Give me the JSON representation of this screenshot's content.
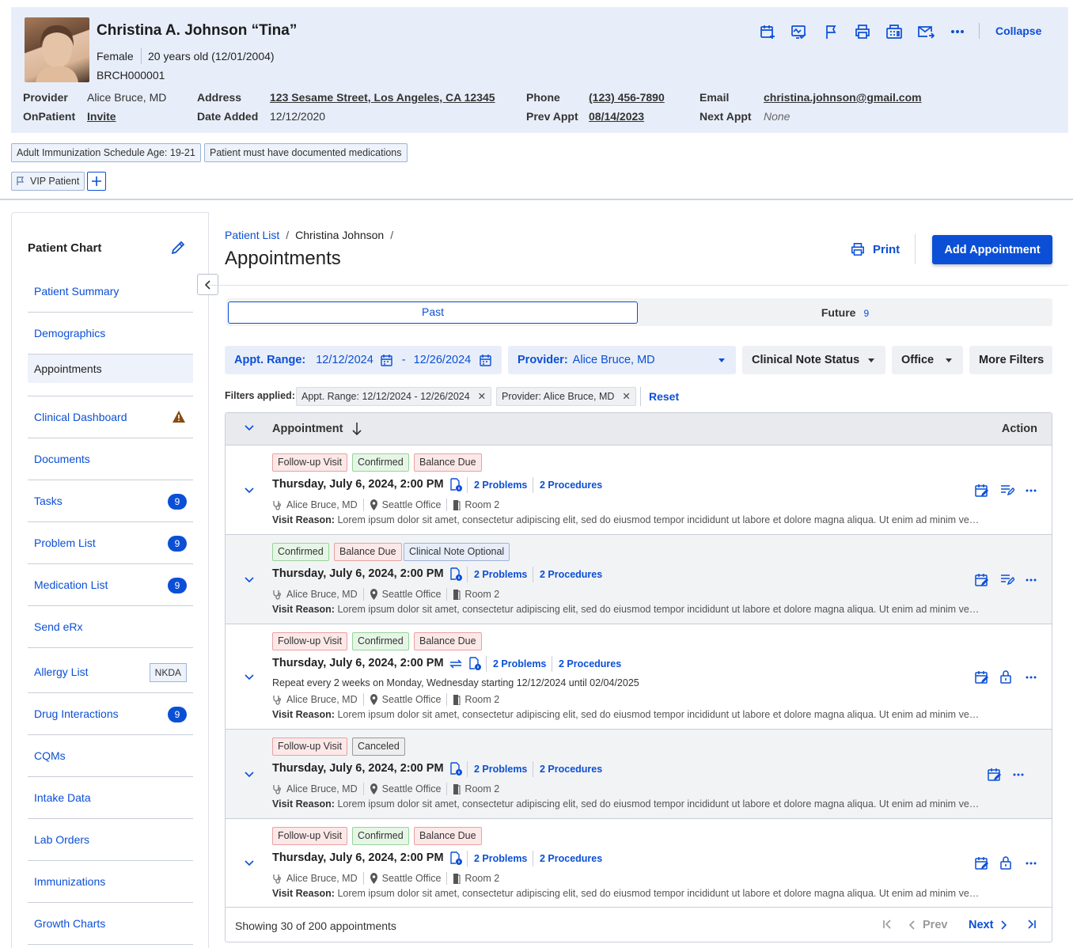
{
  "patient": {
    "name": "Christina A. Johnson “Tina”",
    "gender": "Female",
    "age": "20 years old (12/01/2004)",
    "mrn": "BRCH000001",
    "provider_label": "Provider",
    "provider": "Alice Bruce, MD",
    "onpatient_label": "OnPatient",
    "onpatient": "Invite",
    "address_label": "Address",
    "address": "123 Sesame Street, Los Angeles, CA 12345",
    "date_added_label": "Date Added",
    "date_added": "12/12/2020",
    "phone_label": "Phone",
    "phone": "(123) 456-7890",
    "prev_appt_label": "Prev Appt",
    "prev_appt": "08/14/2023",
    "email_label": "Email",
    "email": "christina.johnson@gmail.com",
    "next_appt_label": "Next Appt",
    "next_appt": "None",
    "collapse": "Collapse"
  },
  "alerts": [
    "Adult Immunization Schedule Age: 19-21",
    "Patient must have documented medications"
  ],
  "flags": {
    "vip": "VIP Patient"
  },
  "sidebar": {
    "title": "Patient Chart",
    "items": [
      {
        "label": "Patient Summary"
      },
      {
        "label": "Demographics"
      },
      {
        "label": "Appointments"
      },
      {
        "label": "Clinical Dashboard"
      },
      {
        "label": "Documents"
      },
      {
        "label": "Tasks",
        "badge": "9"
      },
      {
        "label": "Problem List",
        "badge": "9"
      },
      {
        "label": "Medication List",
        "badge": "9"
      },
      {
        "label": "Send eRx"
      },
      {
        "label": "Allergy List",
        "tag": "NKDA"
      },
      {
        "label": "Drug Interactions",
        "badge": "9"
      },
      {
        "label": "CQMs"
      },
      {
        "label": "Intake Data"
      },
      {
        "label": "Lab Orders"
      },
      {
        "label": "Immunizations"
      },
      {
        "label": "Growth Charts"
      }
    ]
  },
  "breadcrumb": {
    "root": "Patient List",
    "current": "Christina Johnson"
  },
  "page": {
    "title": "Appointments",
    "print": "Print",
    "add": "Add Appointment"
  },
  "tabs": {
    "past": "Past",
    "future": "Future",
    "future_count": "9"
  },
  "filters": {
    "range_label": "Appt. Range:",
    "range_start": "12/12/2024",
    "range_dash": "-",
    "range_end": "12/26/2024",
    "provider_label": "Provider:",
    "provider_value": "Alice Bruce, MD",
    "clinical_note": "Clinical Note Status",
    "office": "Office",
    "more": "More Filters",
    "applied_label": "Filters applied:",
    "applied": [
      "Appt. Range: 12/12/2024 - 12/26/2024",
      "Provider: Alice Bruce, MD"
    ],
    "reset": "Reset"
  },
  "table": {
    "col_appointment": "Appointment",
    "col_action": "Action",
    "rows": [
      {
        "tags": [
          "Follow-up Visit",
          "Confirmed",
          "Balance Due"
        ],
        "when": "Thursday, July 6, 2024, 2:00 PM",
        "problems": "2 Problems",
        "procedures": "2 Procedures",
        "provider": "Alice Bruce, MD",
        "office": "Seattle Office",
        "room": "Room 2",
        "reason_label": "Visit Reason:",
        "reason": "Lorem ipsum dolor sit amet, consectetur adipiscing elit, sed do eiusmod tempor incididunt ut labore et dolore magna aliqua. Ut enim ad minim veniam"
      },
      {
        "tags": [
          "Confirmed",
          "Balance Due",
          "Clinical Note Optional"
        ],
        "when": "Thursday, July 6, 2024, 2:00 PM",
        "problems": "2 Problems",
        "procedures": "2 Procedures",
        "provider": "Alice Bruce, MD",
        "office": "Seattle Office",
        "room": "Room 2",
        "reason_label": "Visit Reason:",
        "reason": "Lorem ipsum dolor sit amet, consectetur adipiscing elit, sed do eiusmod tempor incididunt ut labore et dolore magna aliqua. Ut enim ad minim veniam"
      },
      {
        "tags": [
          "Follow-up Visit",
          "Confirmed",
          "Balance Due"
        ],
        "when": "Thursday, July 6, 2024, 2:00 PM",
        "problems": "2 Problems",
        "procedures": "2 Procedures",
        "repeat": "Repeat every 2 weeks on Monday, Wednesday starting 12/12/2024 until 02/04/2025",
        "provider": "Alice Bruce, MD",
        "office": "Seattle Office",
        "room": "Room 2",
        "reason_label": "Visit Reason:",
        "reason": "Lorem ipsum dolor sit amet, consectetur adipiscing elit, sed do eiusmod tempor incididunt ut labore et dolore magna aliqua. Ut enim ad minim veniam"
      },
      {
        "tags": [
          "Follow-up Visit",
          "Canceled"
        ],
        "when": "Thursday, July 6, 2024, 2:00 PM",
        "problems": "2 Problems",
        "procedures": "2 Procedures",
        "provider": "Alice Bruce, MD",
        "office": "Seattle Office",
        "room": "Room 2",
        "reason_label": "Visit Reason:",
        "reason": "Lorem ipsum dolor sit amet, consectetur adipiscing elit, sed do eiusmod tempor incididunt ut labore et dolore magna aliqua. Ut enim ad minim veniam"
      },
      {
        "tags": [
          "Follow-up Visit",
          "Confirmed",
          "Balance Due"
        ],
        "when": "Thursday, July 6, 2024, 2:00 PM",
        "problems": "2 Problems",
        "procedures": "2 Procedures",
        "provider": "Alice Bruce, MD",
        "office": "Seattle Office",
        "room": "Room 2",
        "reason_label": "Visit Reason:",
        "reason": "Lorem ipsum dolor sit amet, consectetur adipiscing elit, sed do eiusmod tempor incididunt ut labore et dolore magna aliqua. Ut enim ad minim veniam"
      }
    ],
    "showing": "Showing 30 of 200 appointments",
    "prev": "Prev",
    "next": "Next"
  },
  "colors": {
    "accent": "#0b4fd6",
    "header_bg": "#e8eef9",
    "warning": "#8a4b12"
  }
}
